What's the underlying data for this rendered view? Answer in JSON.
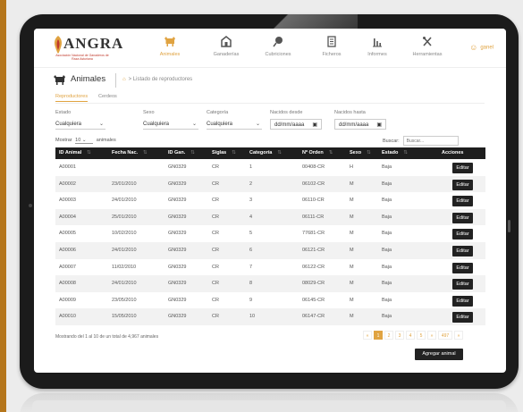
{
  "app": {
    "brand": "ANGRA",
    "brand_sub": "Asociación Nacional de Ganaderos de Raza Asturiana"
  },
  "nav": {
    "items": [
      {
        "label": "Animales",
        "icon": "cow-icon"
      },
      {
        "label": "Ganaderías",
        "icon": "farm-icon"
      },
      {
        "label": "Cubriciones",
        "icon": "breeding-icon"
      },
      {
        "label": "Ficheros",
        "icon": "file-icon"
      },
      {
        "label": "Informes",
        "icon": "chart-icon"
      },
      {
        "label": "Herramientas",
        "icon": "tools-icon"
      }
    ],
    "active_index": 0,
    "user": "ganel"
  },
  "page": {
    "title": "Animales",
    "breadcrumb": "Listado de reproductores"
  },
  "tabs": [
    {
      "label": "Reproductores"
    },
    {
      "label": "Cerdeos"
    }
  ],
  "filters": {
    "estado": {
      "label": "Estado",
      "value": "Cualquiera"
    },
    "sexo": {
      "label": "Sexo",
      "value": "Cualquiera"
    },
    "categoria": {
      "label": "Categoría",
      "value": "Cualquiera"
    },
    "nacidos_desde": {
      "label": "Nacidos desde",
      "placeholder": "dd/mm/aaaa"
    },
    "nacidos_hasta": {
      "label": "Nacidos hasta",
      "placeholder": "dd/mm/aaaa"
    }
  },
  "list_controls": {
    "show_prefix": "Mostrar",
    "page_size": "10",
    "show_suffix": "animales",
    "search_label": "Buscar:",
    "search_placeholder": "Buscar..."
  },
  "table": {
    "columns": [
      "ID Animal",
      "Fecha Nac.",
      "ID Gan.",
      "Siglas",
      "Categoría",
      "Nº Orden",
      "Sexo",
      "Estado",
      "Acciones"
    ],
    "rows": [
      [
        "A00001",
        "",
        "GN0329",
        "CR",
        "1",
        "00408-CR",
        "H",
        "Baja"
      ],
      [
        "A00002",
        "23/01/2010",
        "GN0329",
        "CR",
        "2",
        "06102-CR",
        "M",
        "Baja"
      ],
      [
        "A00003",
        "24/01/2010",
        "GN0329",
        "CR",
        "3",
        "06110-CR",
        "M",
        "Baja"
      ],
      [
        "A00004",
        "25/01/2010",
        "GN0329",
        "CR",
        "4",
        "06111-CR",
        "M",
        "Baja"
      ],
      [
        "A00005",
        "10/02/2010",
        "GN0329",
        "CR",
        "5",
        "77681-CR",
        "M",
        "Baja"
      ],
      [
        "A00006",
        "24/01/2010",
        "GN0329",
        "CR",
        "6",
        "06121-CR",
        "M",
        "Baja"
      ],
      [
        "A00007",
        "11/02/2010",
        "GN0329",
        "CR",
        "7",
        "06122-CR",
        "M",
        "Baja"
      ],
      [
        "A00008",
        "24/01/2010",
        "GN0329",
        "CR",
        "8",
        "08029-CR",
        "M",
        "Baja"
      ],
      [
        "A00009",
        "23/05/2010",
        "GN0329",
        "CR",
        "9",
        "06145-CR",
        "M",
        "Baja"
      ],
      [
        "A00010",
        "15/05/2010",
        "GN0329",
        "CR",
        "10",
        "06147-CR",
        "M",
        "Baja"
      ]
    ],
    "action_label": "Editar"
  },
  "summary": "Mostrando del 1 al 10 de un total de 4,967 animales",
  "pagination": {
    "prev": "«",
    "pages": [
      "1",
      "2",
      "3",
      "4",
      "5"
    ],
    "next": "»",
    "last": "497",
    "end": "»"
  },
  "add_button": "Agregar animal",
  "colors": {
    "accent": "#e0a341",
    "header_bg": "#1e1e1e",
    "tablet": "#1b1b1b"
  }
}
